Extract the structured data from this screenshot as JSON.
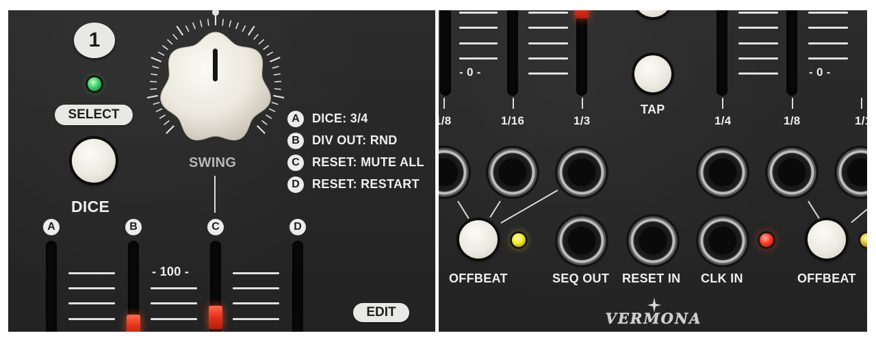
{
  "left_panel": {
    "channel_number": "1",
    "select_label": "SELECT",
    "dice_label": "DICE",
    "swing_label": "SWING",
    "edit_label": "EDIT",
    "fader_scale_label": "- 100 -",
    "fader_letters": [
      "A",
      "B",
      "C",
      "D"
    ],
    "shortcuts": [
      {
        "key": "A",
        "text": "DICE: 3/4"
      },
      {
        "key": "B",
        "text": "DIV OUT: RND"
      },
      {
        "key": "C",
        "text": "RESET: MUTE ALL"
      },
      {
        "key": "D",
        "text": "RESET: RESTART"
      }
    ],
    "colors": {
      "led_select": "#3fd06a",
      "fader_cap": "#e7341d"
    }
  },
  "right_panel": {
    "fader_zero_left": "- 0 -",
    "fader_zero_right": "- 0 -",
    "tap_label": "TAP",
    "division_labels": [
      "1/8",
      "1/16",
      "1/3",
      "1/4",
      "1/8",
      "1/1"
    ],
    "offbeat_left_label": "OFFBEAT",
    "offbeat_right_label": "OFFBEAT",
    "seq_out_label": "SEQ OUT",
    "reset_in_label": "RESET IN",
    "clk_in_label": "CLK IN",
    "brand": "VERMONA",
    "colors": {
      "led_offbeat": "#f2ea2a",
      "led_clock": "#ff3b23"
    }
  }
}
